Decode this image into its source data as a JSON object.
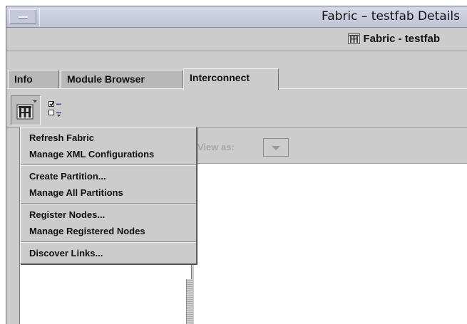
{
  "window": {
    "title": "Fabric – testfab Details"
  },
  "header": {
    "label": "Fabric - testfab"
  },
  "tabs": [
    {
      "label": "Info",
      "active": false
    },
    {
      "label": "Module Browser",
      "active": false
    },
    {
      "label": "Interconnect",
      "active": true
    }
  ],
  "toolbar": {
    "fabric_menu_icon": "fabric-icon",
    "select_icon": "checkbox-list-icon"
  },
  "view_as": {
    "label": "View as:",
    "value": ""
  },
  "popup_menu": {
    "groups": [
      {
        "items": [
          "Refresh Fabric",
          "Manage XML Configurations"
        ]
      },
      {
        "items": [
          "Create Partition...",
          "Manage All Partitions"
        ]
      },
      {
        "items": [
          "Register Nodes...",
          "Manage Registered Nodes"
        ]
      },
      {
        "items": [
          "Discover Links..."
        ]
      }
    ]
  }
}
